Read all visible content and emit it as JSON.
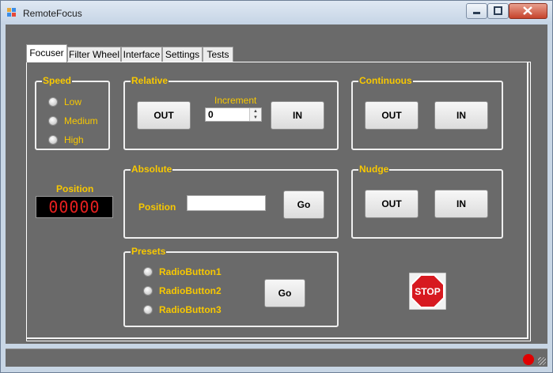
{
  "window": {
    "title": "RemoteFocus"
  },
  "tabs": [
    {
      "label": "Focuser",
      "active": true
    },
    {
      "label": "Filter Wheel",
      "active": false
    },
    {
      "label": "Interface",
      "active": false
    },
    {
      "label": "Settings",
      "active": false
    },
    {
      "label": "Tests",
      "active": false
    }
  ],
  "speed": {
    "title": "Speed",
    "options": [
      "Low",
      "Medium",
      "High"
    ]
  },
  "relative": {
    "title": "Relative",
    "out_label": "OUT",
    "in_label": "IN",
    "increment_label": "Increment",
    "increment_value": "0"
  },
  "continuous": {
    "title": "Continuous",
    "out_label": "OUT",
    "in_label": "IN"
  },
  "position_display": {
    "label": "Position",
    "value": "00000"
  },
  "absolute": {
    "title": "Absolute",
    "position_label": "Position",
    "position_value": "",
    "go_label": "Go"
  },
  "nudge": {
    "title": "Nudge",
    "out_label": "OUT",
    "in_label": "IN"
  },
  "presets": {
    "title": "Presets",
    "options": [
      "RadioButton1",
      "RadioButton2",
      "RadioButton3"
    ],
    "go_label": "Go"
  },
  "stop": {
    "label": "STOP"
  },
  "colors": {
    "accent": "#f8c800",
    "panel": "#6a6a6a",
    "display_text": "#e82020",
    "stop_red": "#d71920",
    "status_lamp": "#e00000"
  }
}
